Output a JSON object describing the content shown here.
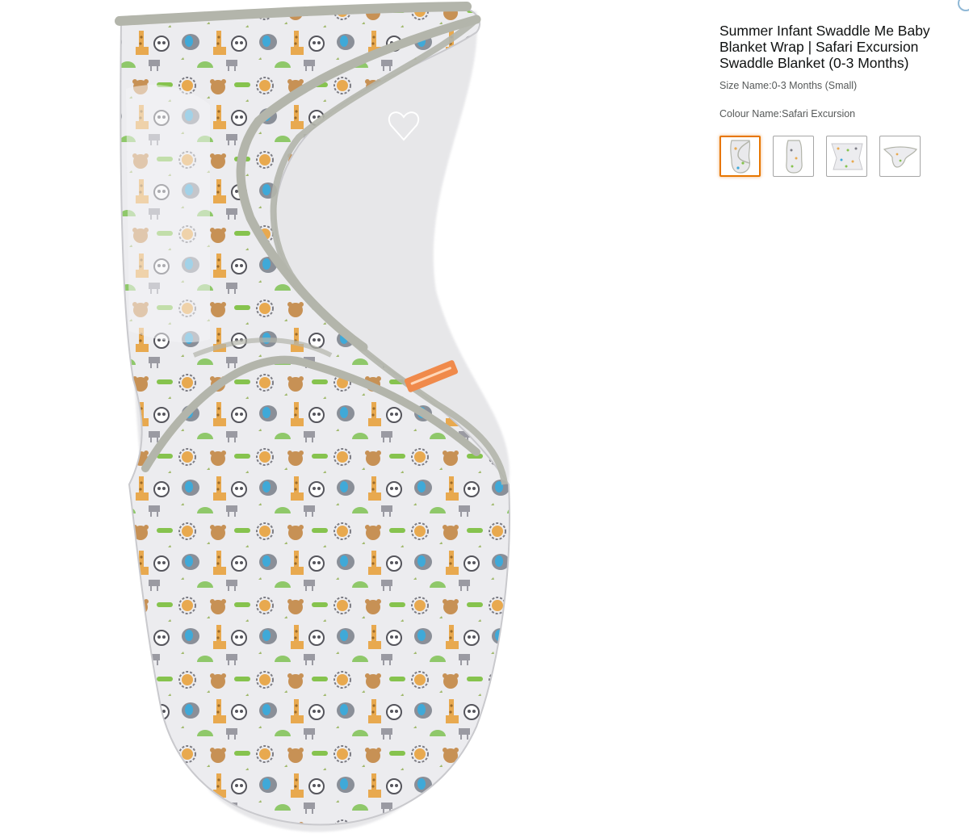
{
  "product": {
    "title": "Summer Infant Swaddle Me Baby Blanket Wrap | Safari Excursion Swaddle Blanket (0-3 Months)",
    "size_label": "Size Name:",
    "size_value": "0-3 Months (Small)",
    "colour_label": "Colour Name:",
    "colour_value": "Safari Excursion"
  },
  "main_image": {
    "icon": "swaddle-product-image",
    "fabric_color": "#ececef",
    "trim_color": "#b3b5ab",
    "pattern_colors": [
      "#e8a94f",
      "#86c34e",
      "#3fa9d8",
      "#7c7c84",
      "#9b8a6b"
    ]
  },
  "thumbnails": [
    {
      "icon": "swaddle-wrapped-thumbnail",
      "selected": true
    },
    {
      "icon": "swaddle-side-thumbnail",
      "selected": false
    },
    {
      "icon": "swaddle-flat-thumbnail",
      "selected": false
    },
    {
      "icon": "swaddle-open-thumbnail",
      "selected": false
    }
  ],
  "colors": {
    "selected_border": "#e77600",
    "thumb_border": "#a6a6a6"
  }
}
